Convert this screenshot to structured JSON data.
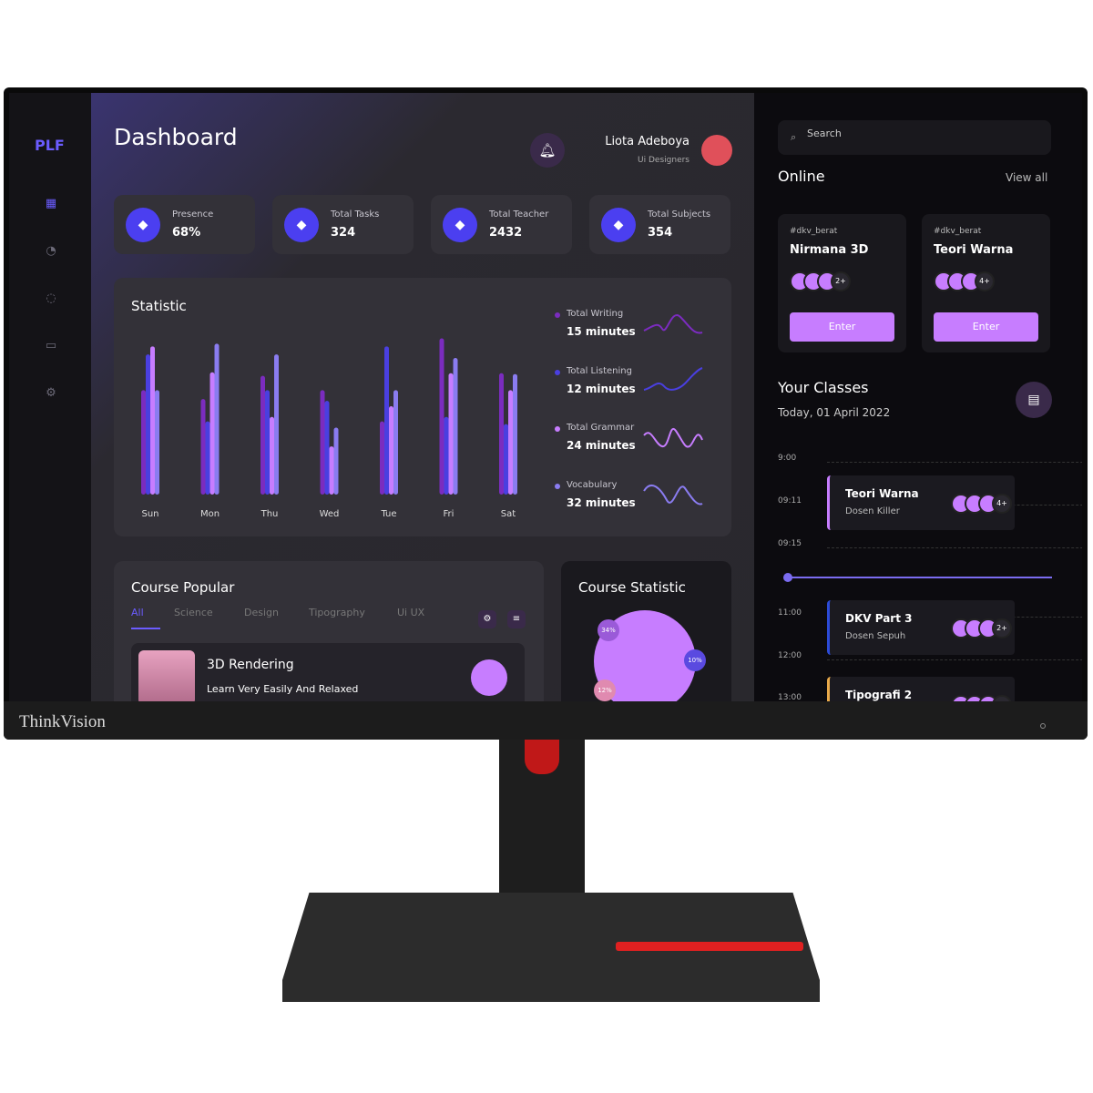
{
  "brand": "ThinkVision",
  "sidebar": {
    "logo": "PLF",
    "icons": [
      "grid-icon",
      "pie-chart-icon",
      "chat-icon",
      "wallet-icon",
      "settings-icon"
    ]
  },
  "header": {
    "title": "Dashboard",
    "user_name": "Liota Adeboya",
    "user_role": "Ui Designers"
  },
  "stats": [
    {
      "label": "Presence",
      "value": "68%",
      "icon": "chart-up-icon"
    },
    {
      "label": "Total Tasks",
      "value": "324",
      "icon": "document-icon"
    },
    {
      "label": "Total Teacher",
      "value": "2432",
      "icon": "graduation-cap-icon"
    },
    {
      "label": "Total Subjects",
      "value": "354",
      "icon": "megaphone-icon"
    }
  ],
  "statistic": {
    "title": "Statistic",
    "legend": [
      {
        "label": "Total Writing",
        "value": "15 minutes",
        "color": "#7b2cbf"
      },
      {
        "label": "Total Listening",
        "value": "12 minutes",
        "color": "#4a3fe0"
      },
      {
        "label": "Total Grammar",
        "value": "24 minutes",
        "color": "#c77dff"
      },
      {
        "label": "Vocabulary",
        "value": "32 minutes",
        "color": "#8a7cf0"
      }
    ]
  },
  "chart_data": {
    "type": "bar",
    "title": "Statistic",
    "categories": [
      "Sun",
      "Mon",
      "Thu",
      "Wed",
      "Tue",
      "Fri",
      "Sat"
    ],
    "ylim": [
      0,
      180
    ],
    "grid": false,
    "series": [
      {
        "name": "Total Writing",
        "color": "#7b2cbf",
        "values": [
          117,
          107,
          133,
          117,
          82,
          175,
          136
        ]
      },
      {
        "name": "Total Listening",
        "color": "#4a3fe0",
        "values": [
          157,
          82,
          117,
          105,
          166,
          87,
          79
        ]
      },
      {
        "name": "Total Grammar",
        "color": "#c77dff",
        "values": [
          166,
          137,
          87,
          54,
          99,
          136,
          117
        ]
      },
      {
        "name": "Vocabulary",
        "color": "#8a7cf0",
        "values": [
          117,
          169,
          157,
          75,
          117,
          153,
          135
        ]
      }
    ]
  },
  "course_popular": {
    "title": "Course Popular",
    "tabs": [
      "All",
      "Science",
      "Design",
      "Tipography",
      "Ui UX"
    ],
    "item_title": "3D Rendering",
    "item_sub": "Learn Very Easily And Relaxed"
  },
  "course_statistic": {
    "title": "Course Statistic",
    "labels": [
      "34%",
      "10%",
      "12%"
    ]
  },
  "search": {
    "placeholder": "Search"
  },
  "online": {
    "title": "Online",
    "view_all": "View all",
    "rooms": [
      {
        "tag": "#dkv_berat",
        "name": "Nirmana 3D",
        "more": "2+",
        "button": "Enter"
      },
      {
        "tag": "#dkv_berat",
        "name": "Teori Warna",
        "more": "4+",
        "button": "Enter"
      }
    ]
  },
  "classes": {
    "title": "Your Classes",
    "date": "Today, 01 April 2022",
    "times": [
      "9:00",
      "09:11",
      "09:15",
      "11:00",
      "12:00",
      "13:00"
    ],
    "items": [
      {
        "name": "Teori Warna",
        "teacher": "Dosen Killer",
        "more": "4+",
        "color": "#c77dff"
      },
      {
        "name": "DKV Part 3",
        "teacher": "Dosen Sepuh",
        "more": "2+",
        "color": "#2c4bd8"
      },
      {
        "name": "Tipografi 2",
        "teacher": "",
        "more": "",
        "color": "#e8a94a"
      }
    ]
  }
}
